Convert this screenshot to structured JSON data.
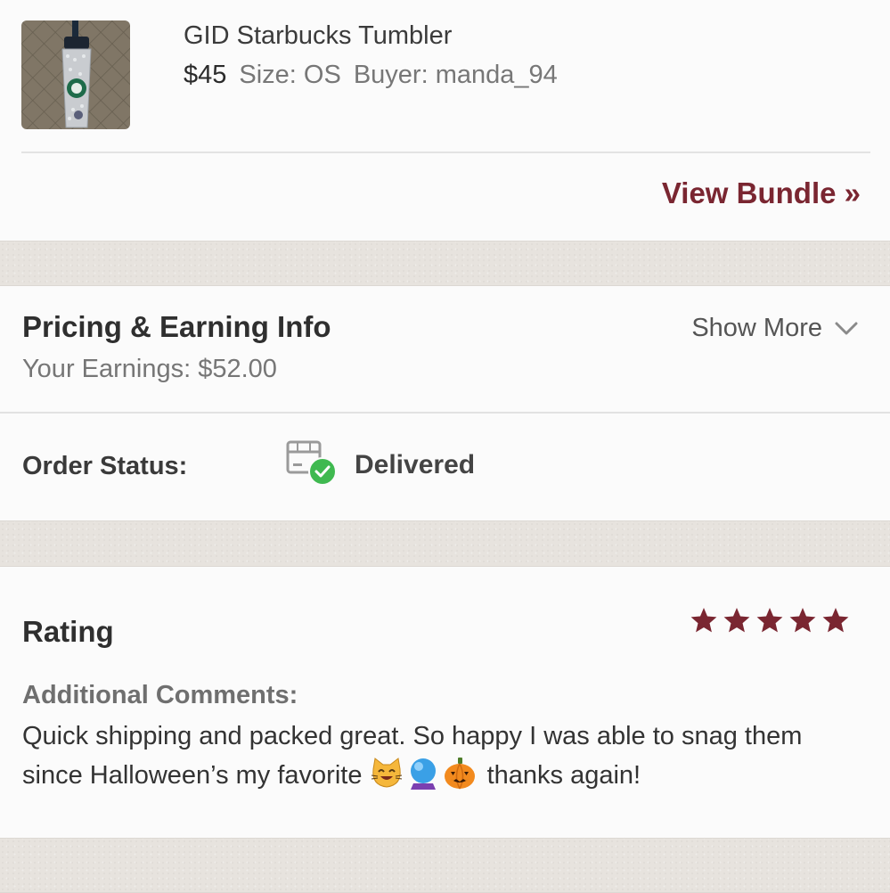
{
  "item": {
    "title": "GID Starbucks Tumbler",
    "price": "$45",
    "size": "Size: OS",
    "buyer": "Buyer: manda_94",
    "view_bundle": "View Bundle »"
  },
  "pricing": {
    "title": "Pricing & Earning Info",
    "earnings": "Your Earnings: $52.00",
    "show_more": "Show More"
  },
  "order": {
    "label": "Order Status:",
    "status": "Delivered"
  },
  "rating": {
    "title": "Rating",
    "stars": 5,
    "max_stars": 5,
    "comments_label": "Additional Comments:",
    "comments_text_1": "Quick shipping and packed great. So happy I was able to snag them since Halloween’s my favorite",
    "comments_text_2": "thanks again!"
  },
  "colors": {
    "accent": "#7a2631",
    "success": "#3fb950",
    "star": "#7a2631"
  },
  "icons": [
    "package-delivered-icon",
    "chevron-down-icon",
    "star-icon",
    "cat-emoji-icon",
    "crystal-ball-emoji-icon",
    "pumpkin-emoji-icon"
  ]
}
